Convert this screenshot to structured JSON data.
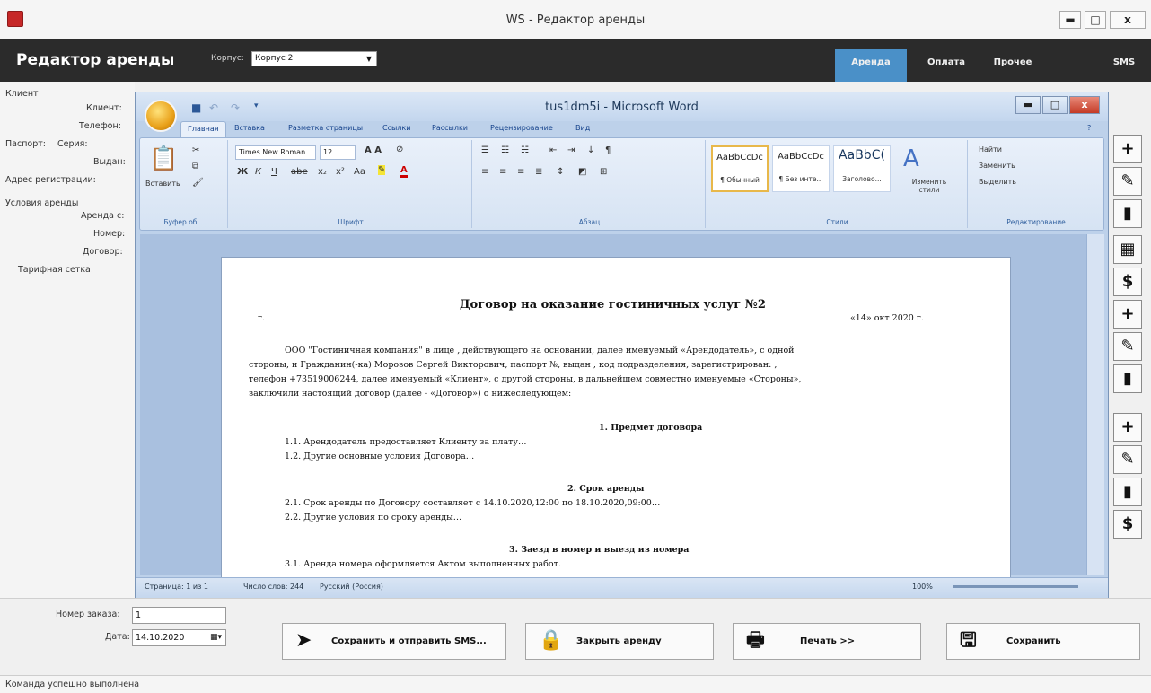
{
  "window": {
    "title": "WS - Редактор аренды",
    "minimize": "▬",
    "maximize": "□",
    "close": "x"
  },
  "header": {
    "title": "Редактор аренды",
    "korpus_label": "Корпус:",
    "korpus_value": "Корпус 2",
    "tabs": [
      "Аренда",
      "Оплата",
      "Прочее",
      "SMS"
    ],
    "active_tab": "Аренда"
  },
  "form": {
    "client_section": "Клиент",
    "client": "Клиент:",
    "phone": "Телефон:",
    "passport": "Паспорт:",
    "series": "Серия:",
    "issued": "Выдан:",
    "address": "Адрес регистрации:",
    "conditions": "Условия аренды",
    "rent_from": "Аренда с:",
    "room": "Номер:",
    "contract": "Договор:",
    "tariff": "Тарифная сетка:"
  },
  "word": {
    "title": "tus1dm5i - Microsoft Word",
    "tabs": [
      "Главная",
      "Вставка",
      "Разметка страницы",
      "Ссылки",
      "Рассылки",
      "Рецензирование",
      "Вид"
    ],
    "groups": {
      "clipboard": "Буфер об...",
      "font": "Шрифт",
      "paragraph": "Абзац",
      "styles": "Стили",
      "editing": "Редактирование"
    },
    "paste": "Вставить",
    "font_name": "Times New Roman",
    "font_size": "12",
    "styles": [
      {
        "sample": "AaBbCcDc",
        "name": "¶ Обычный"
      },
      {
        "sample": "AaBbCcDc",
        "name": "¶ Без инте..."
      },
      {
        "sample": "AaBbC(",
        "name": "Заголово..."
      }
    ],
    "change_styles": "Изменить стили",
    "edit": {
      "find": "Найти",
      "replace": "Заменить",
      "select": "Выделить"
    },
    "doc": {
      "heading": "Договор на оказание гостиничных услуг №2",
      "city": "г.",
      "date": "«14» окт 2020 г.",
      "p1": "ООО \"Гостиничная компания\" в лице , действующего на основании, далее именуемый «Арендодатель», с одной",
      "p2": "стороны, и Гражданин(-ка) Морозов Сергей Викторович, паспорт №, выдан , код подразделения, зарегистрирован: ,",
      "p3": "телефон +73519006244, далее именуемый «Клиент», с другой стороны, в дальнейшем совместно именуемые «Стороны»,",
      "p4": "заключили настоящий договор (далее - «Договор») о нижеследующем:",
      "s1": "1. Предмет договора",
      "s1_1": "1.1. Арендодатель предоставляет Клиенту за плату…",
      "s1_2": "1.2. Другие основные условия Договора…",
      "s2": "2. Срок аренды",
      "s2_1": "2.1. Срок аренды по Договору составляет с 14.10.2020,12:00 по 18.10.2020,09:00…",
      "s2_2": "2.2. Другие условия по сроку аренды…",
      "s3": "3. Заезд в номер и выезд из номера",
      "s3_1": "3.1. Аренда номера оформляется Актом выполненных работ."
    },
    "status": {
      "page": "Страница: 1 из 1",
      "words": "Число слов: 244",
      "lang": "Русский (Россия)",
      "zoom": "100%"
    }
  },
  "bottom": {
    "order_label": "Номер заказа:",
    "order_value": "1",
    "date_label": "Дата:",
    "date_value": "14.10.2020",
    "buttons": [
      "Сохранить и отправить SMS...",
      "Закрыть аренду",
      "Печать  >>",
      "Сохранить"
    ]
  },
  "statusbar": "Команда успешно выполнена"
}
